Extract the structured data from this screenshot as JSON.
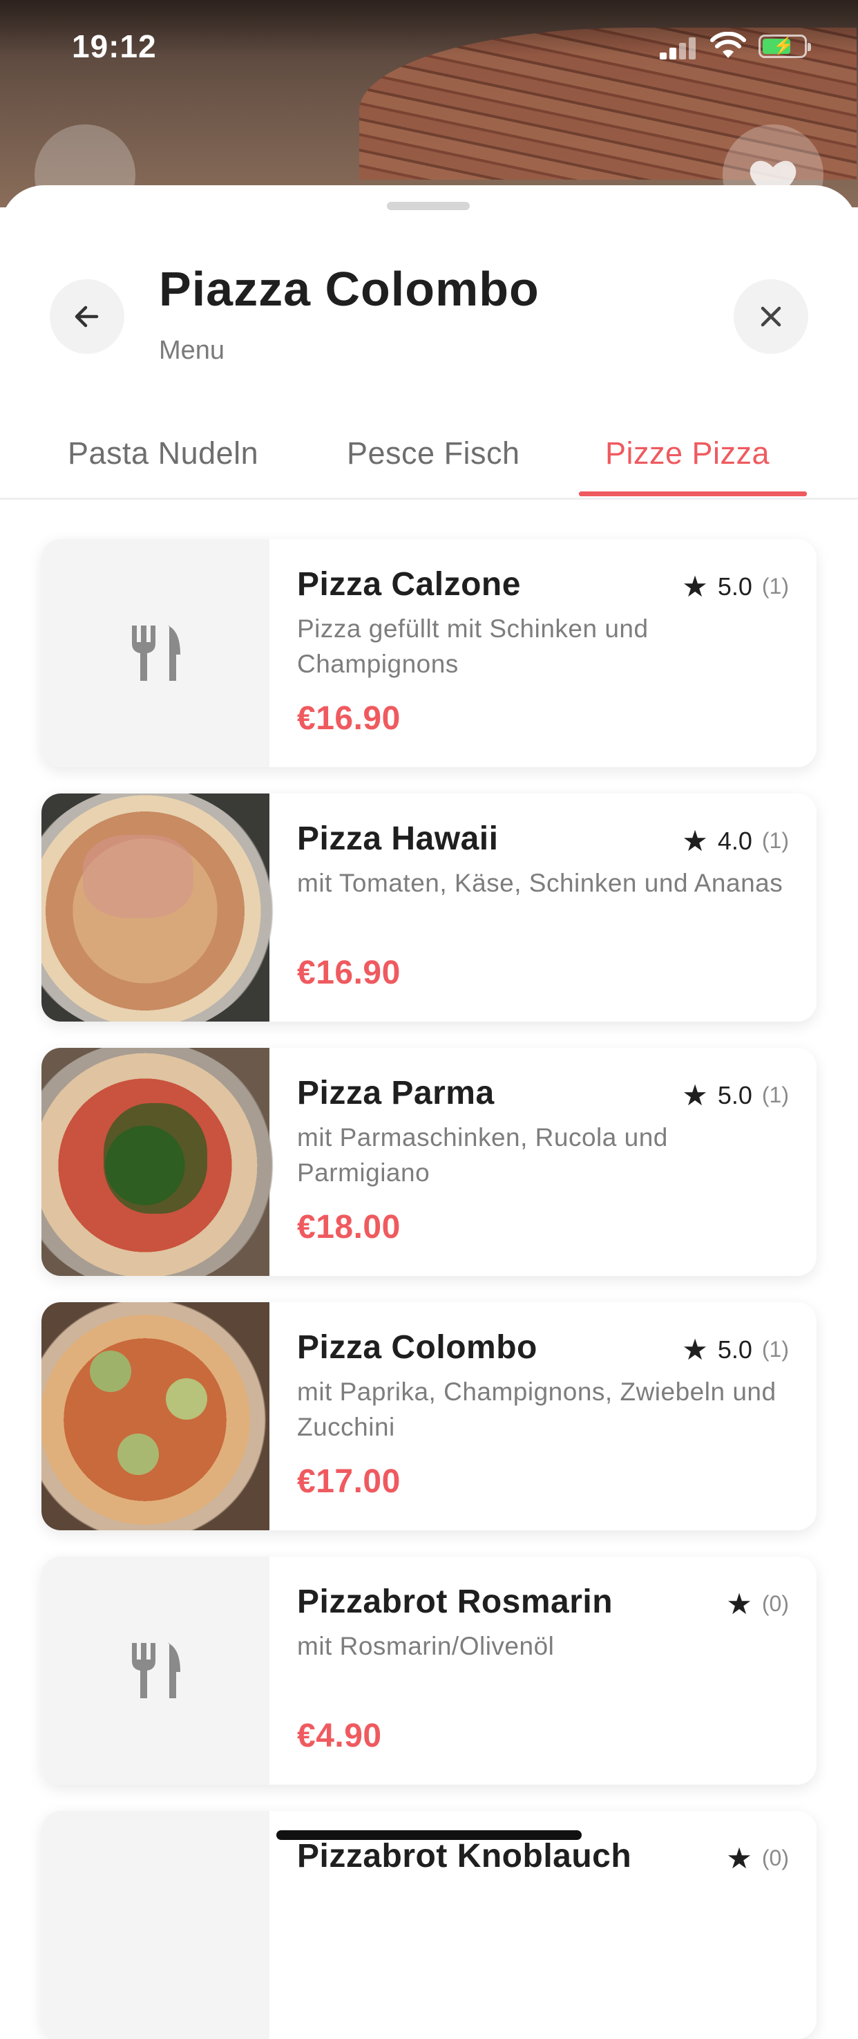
{
  "status_bar": {
    "time": "19:12"
  },
  "header": {
    "title": "Piazza Colombo",
    "subtitle": "Menu"
  },
  "tabs": [
    {
      "label": "Pasta Nudeln",
      "active": false
    },
    {
      "label": "Pesce Fisch",
      "active": false
    },
    {
      "label": "Pizze Pizza",
      "active": true
    }
  ],
  "colors": {
    "accent": "#ef5a5f",
    "text": "#1f1f1f",
    "muted": "#7d7d7d"
  },
  "items": [
    {
      "name": "Pizza Calzone",
      "rating": "5.0",
      "count": "(1)",
      "desc": "Pizza gefüllt mit Schinken und Champignons",
      "price": "€16.90",
      "image": "placeholder-fork-knife-icon"
    },
    {
      "name": "Pizza Hawaii",
      "rating": "4.0",
      "count": "(1)",
      "desc": "mit Tomaten, Käse, Schinken und Ananas",
      "price": "€16.90",
      "image": "pizza-photo"
    },
    {
      "name": "Pizza Parma",
      "rating": "5.0",
      "count": "(1)",
      "desc": "mit Parmaschinken, Rucola und Parmigiano",
      "price": "€18.00",
      "image": "pizza-photo"
    },
    {
      "name": "Pizza Colombo",
      "rating": "5.0",
      "count": "(1)",
      "desc": "mit Paprika, Champignons, Zwiebeln und Zucchini",
      "price": "€17.00",
      "image": "pizza-photo"
    },
    {
      "name": "Pizzabrot Rosmarin",
      "rating": "",
      "count": "(0)",
      "desc": "mit Rosmarin/Olivenöl",
      "price": "€4.90",
      "image": "placeholder-fork-knife-icon"
    },
    {
      "name": "Pizzabrot Knoblauch",
      "rating": "",
      "count": "(0)",
      "desc": "",
      "price": "",
      "image": "placeholder-fork-knife-icon"
    }
  ]
}
